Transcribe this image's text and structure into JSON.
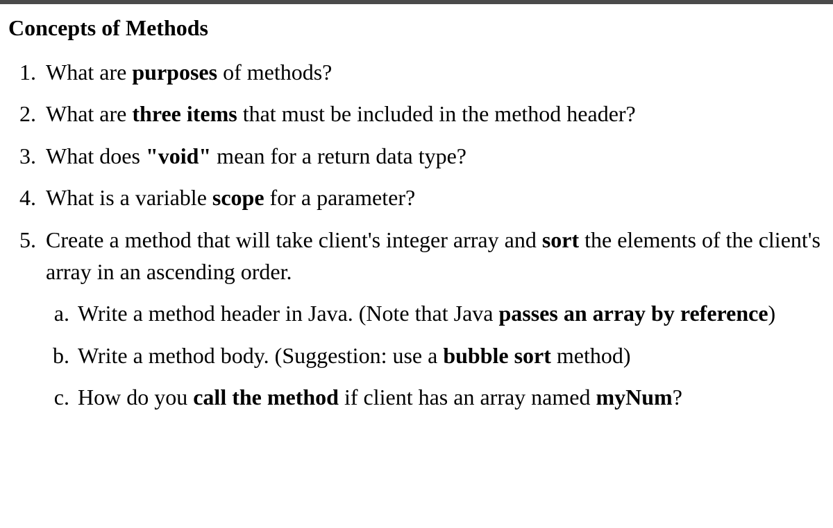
{
  "heading": "Concepts of Methods",
  "q1": {
    "p1": "What are ",
    "b1": "purposes",
    "p2": " of methods?"
  },
  "q2": {
    "p1": "What are ",
    "b1": "three items",
    "p2": " that must be included in the method header?"
  },
  "q3": {
    "p1": "What does ",
    "b1": "\"void\"",
    "p2": " mean for a return data type?"
  },
  "q4": {
    "p1": "What is a variable ",
    "b1": "scope",
    "p2": " for a parameter?"
  },
  "q5": {
    "p1": "Create a method that will take client's integer array and ",
    "b1": "sort",
    "p2": " the elements of the client's array in an ascending order.",
    "a": {
      "p1": "Write a method header in Java. (Note that Java ",
      "b1": "passes an array by reference",
      "p2": ")"
    },
    "b": {
      "p1": "Write a method body. (Suggestion: use a ",
      "b1": "bubble sort",
      "p2": " method)"
    },
    "c": {
      "p1": "How do you ",
      "b1": "call the method",
      "p2": " if client has an array named ",
      "b2": "myNum",
      "p3": "?"
    }
  }
}
